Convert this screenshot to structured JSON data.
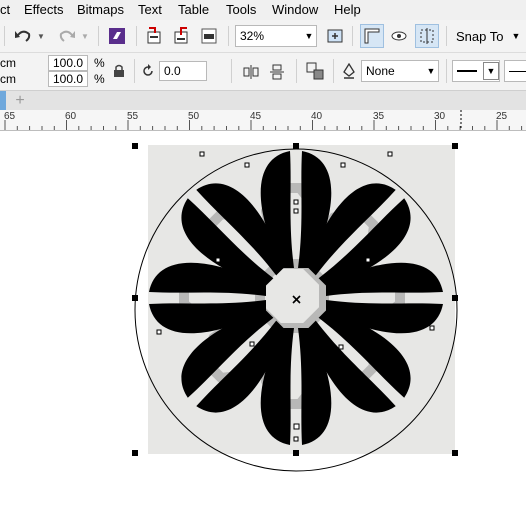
{
  "menu": [
    "ct",
    "Effects",
    "Bitmaps",
    "Text",
    "Table",
    "Tools",
    "Window",
    "Help"
  ],
  "toolbar": {
    "zoom": "32%",
    "snap_to": "Snap To"
  },
  "properties": {
    "width_unit": "cm",
    "height_unit": "cm",
    "scale_x": "100.0",
    "scale_y": "100.0",
    "percent": "%",
    "rotation": "0.0",
    "outline": "None"
  },
  "ruler": {
    "labels": [
      "65",
      "60",
      "55",
      "50",
      "45",
      "40",
      "35",
      "30",
      "25"
    ]
  },
  "icons": {
    "undo": "undo-icon",
    "redo": "redo-icon",
    "center": "x-mark-icon"
  }
}
